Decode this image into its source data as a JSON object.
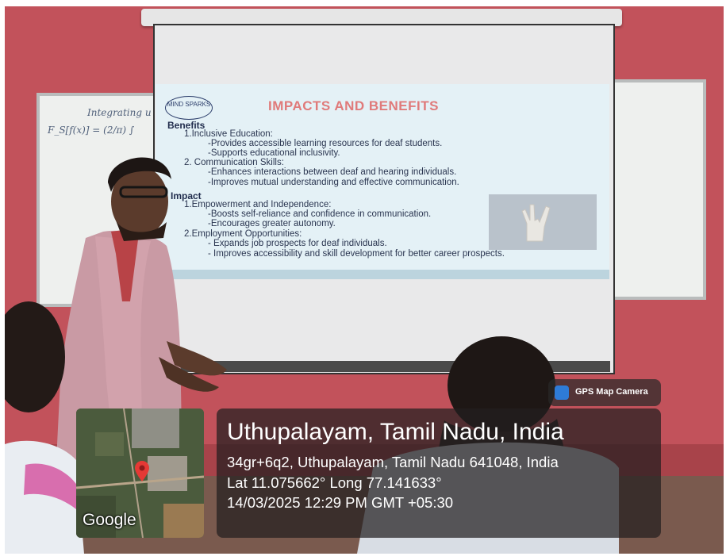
{
  "slide": {
    "logo_text": "MIND SPARKS",
    "title": "IMPACTS AND BENEFITS",
    "lines": [
      "Benefits",
      "1.Inclusive Education:",
      "-Provides accessible learning resources for deaf students.",
      "-Supports educational inclusivity.",
      "2. Communication Skills:",
      "-Enhances interactions between deaf and hearing individuals.",
      "-Improves mutual understanding and effective communication.",
      "Impact",
      "1.Empowerment and Independence:",
      "-Boosts self-reliance and confidence in communication.",
      "-Encourages greater autonomy.",
      "2.Employment Opportunities:",
      "- Expands job prospects for deaf individuals.",
      "- Improves accessibility and skill development for better career prospects."
    ]
  },
  "whiteboard": {
    "scribble_1": "Integrating u",
    "scribble_2": "F_S[f(x)] = (2/π) ∫"
  },
  "overlay": {
    "app_badge": "GPS Map Camera",
    "app_icon": "camera-pin-icon",
    "map_attribution": "Google",
    "location_title": "Uthupalayam, Tamil Nadu, India",
    "address": "34gr+6q2, Uthupalayam, Tamil Nadu 641048, India",
    "coordinates": "Lat 11.075662° Long 77.141633°",
    "datetime": "14/03/2025 12:29 PM GMT +05:30"
  },
  "colors": {
    "wall": "#c2525b",
    "slide_title": "#e07a7a",
    "slide_text": "#2a3550",
    "overlay_bg": "#231e20",
    "map_pin": "#e53935"
  }
}
